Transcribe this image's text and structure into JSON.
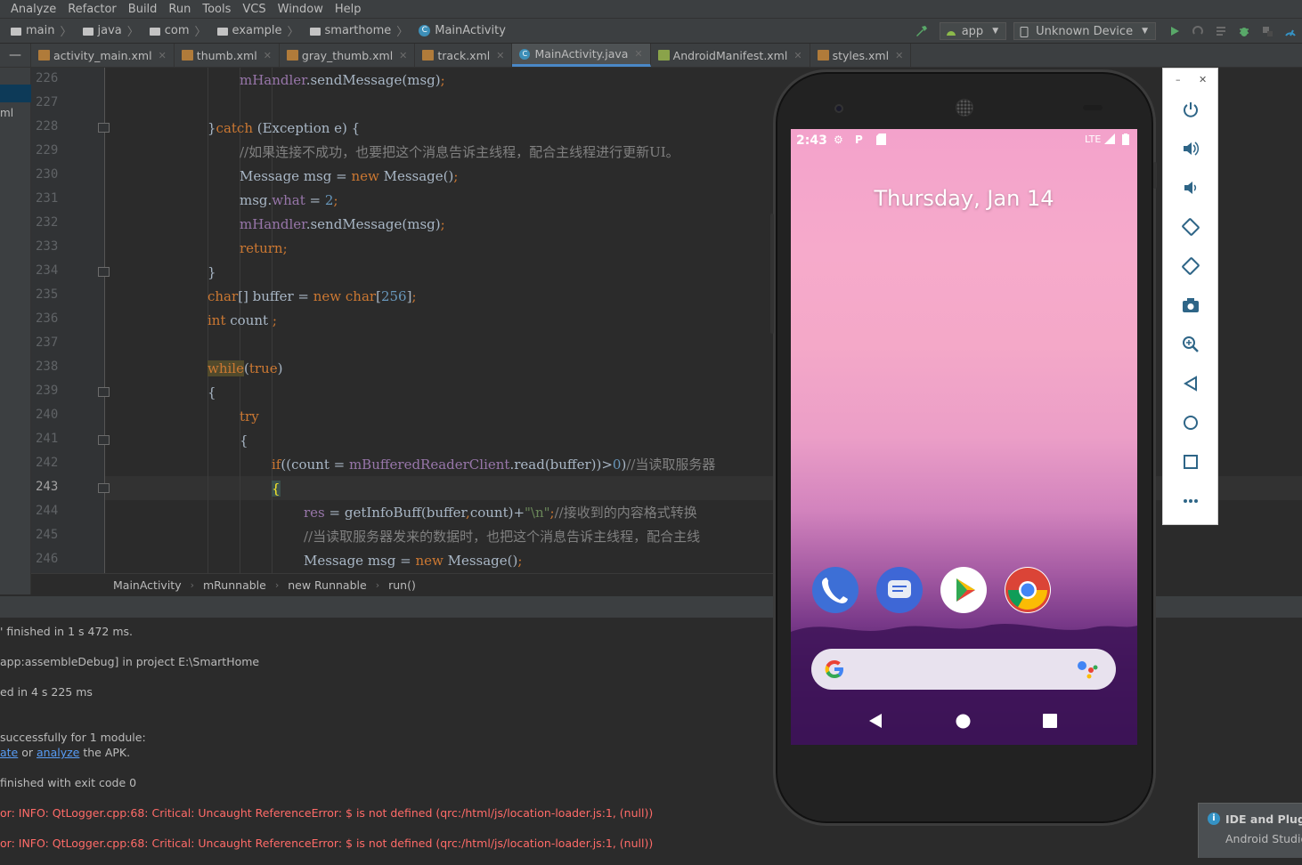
{
  "menubar": {
    "items": [
      "Analyze",
      "Refactor",
      "Build",
      "Run",
      "Tools",
      "VCS",
      "Window",
      "Help"
    ]
  },
  "navbar": {
    "crumbs": [
      "main",
      "java",
      "com",
      "example",
      "smarthome",
      "MainActivity"
    ],
    "run_config": "app",
    "device": "Unknown Device"
  },
  "tabs": [
    {
      "label": "activity_main.xml",
      "type": "xml"
    },
    {
      "label": "thumb.xml",
      "type": "xml"
    },
    {
      "label": "gray_thumb.xml",
      "type": "xml"
    },
    {
      "label": "track.xml",
      "type": "xml"
    },
    {
      "label": "MainActivity.java",
      "type": "java",
      "active": true
    },
    {
      "label": "AndroidManifest.xml",
      "type": "xml"
    },
    {
      "label": "styles.xml",
      "type": "xml"
    }
  ],
  "left_panel": {
    "label": "ml"
  },
  "editor": {
    "current_line": "243",
    "line_numbers": [
      "226",
      "227",
      "228",
      "229",
      "230",
      "231",
      "232",
      "233",
      "234",
      "235",
      "236",
      "237",
      "238",
      "239",
      "240",
      "241",
      "242",
      "243",
      "244",
      "245",
      "246"
    ],
    "lines": {
      "l226": {
        "a": "mHandler",
        "b": ".sendMessage(msg)",
        "c": ";"
      },
      "l228": {
        "a": "}",
        "b": "catch",
        "c": " (Exception e) {"
      },
      "l229": {
        "a": "//如果连接不成功，也要把这个消息告诉主线程，配合主线程进行更新UI。"
      },
      "l230": {
        "a": "Message msg = ",
        "b": "new",
        "c": " Message()",
        "d": ";"
      },
      "l231": {
        "a": "msg.",
        "b": "what",
        "c": " = ",
        "d": "2",
        "e": ";"
      },
      "l232": {
        "a": "mHandler",
        "b": ".sendMessage(msg)",
        "c": ";"
      },
      "l233": {
        "a": "return;"
      },
      "l234": {
        "a": "}"
      },
      "l235": {
        "a": "char",
        "b": "[] buffer = ",
        "c": "new",
        "d": " char",
        "e": "[",
        "f": "256",
        "g": "]",
        "h": ";"
      },
      "l236": {
        "a": "int",
        "b": " count ",
        "c": ";"
      },
      "l238": {
        "a": "while",
        "b": "(",
        "c": "true",
        "d": ")"
      },
      "l239": {
        "a": "{"
      },
      "l240": {
        "a": "try"
      },
      "l241": {
        "a": "{"
      },
      "l242": {
        "a": "if",
        "b": "((count = ",
        "c": "mBufferedReaderClient",
        "d": ".read(buffer))>",
        "e": "0",
        "f": ")",
        "g": "//当读取服务器"
      },
      "l243": {
        "a": "{"
      },
      "l244": {
        "a": "res",
        "b": " = getInfoBuff(buffer",
        "c": ",",
        "d": "count)+",
        "e": "\"\\n\"",
        "f": ";",
        "g": "//接收到的内容格式转换"
      },
      "l245": {
        "a": "//当读取服务器发来的数据时，也把这个消息告诉主线程，配合主线"
      },
      "l246": {
        "a": "Message msg = ",
        "b": "new",
        "c": " Message()",
        "d": ";"
      }
    }
  },
  "breadcrumb": [
    "MainActivity",
    "mRunnable",
    "new Runnable",
    "run()"
  ],
  "console": {
    "lines": [
      {
        "text": "' finished in 1 s 472 ms.",
        "err": false
      },
      {
        "text": "app:assembleDebug] in project E:\\SmartHome",
        "err": false
      },
      {
        "text": "ed in 4 s 225 ms",
        "err": false
      },
      {
        "text": "successfully for 1 module:",
        "err": false
      },
      {
        "pre": "ate",
        "mid": " or ",
        "link": "analyze",
        "post": " the APK."
      },
      {
        "text": " finished with exit code 0",
        "err": false
      },
      {
        "text": "or: INFO: QtLogger.cpp:68: Critical: Uncaught ReferenceError: $ is not defined (qrc:/html/js/location-loader.js:1, (null))",
        "err": true
      },
      {
        "text": "or: INFO: QtLogger.cpp:68: Critical: Uncaught ReferenceError: $ is not defined (qrc:/html/js/location-loader.js:1, (null))",
        "err": true
      }
    ]
  },
  "emulator": {
    "time": "2:43",
    "network": "LTE",
    "date": "Thursday, Jan 14",
    "apps": [
      "phone-icon",
      "messages-icon",
      "play-store-icon",
      "chrome-icon"
    ],
    "toolbar": [
      "power-icon",
      "volume-up-icon",
      "volume-down-icon",
      "rotate-left-icon",
      "rotate-right-icon",
      "camera-icon",
      "zoom-icon",
      "back-icon",
      "home-icon",
      "overview-icon",
      "more-icon"
    ]
  },
  "notification": {
    "title": "IDE and Plugi",
    "subtitle": "Android Studio"
  },
  "colors": {
    "keyword": "#cc7832",
    "field": "#9876aa",
    "number": "#6897bb",
    "string": "#6a8759",
    "comment": "#808080",
    "text": "#a9b7c6",
    "error": "#ff6b68",
    "link": "#589df6"
  }
}
